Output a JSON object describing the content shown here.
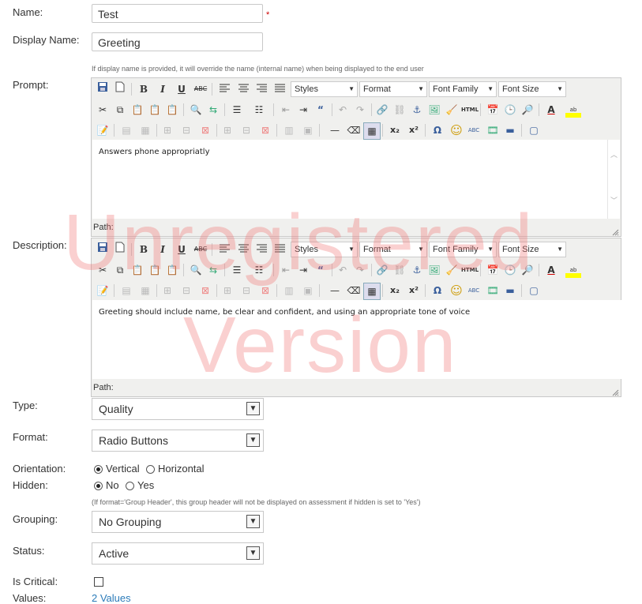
{
  "fields": {
    "name_label": "Name:",
    "name_value": "Test",
    "required_mark": "*",
    "display_name_label": "Display Name:",
    "display_name_value": "Greeting",
    "display_name_hint": "If display name is provided, it will override the name (internal name) when being displayed to the end user",
    "prompt_label": "Prompt:",
    "description_label": "Description:",
    "type_label": "Type:",
    "type_value": "Quality",
    "format_label": "Format:",
    "format_value": "Radio Buttons",
    "orientation_label": "Orientation:",
    "orientation_vertical": "Vertical",
    "orientation_horizontal": "Horizontal",
    "hidden_label": "Hidden:",
    "hidden_no": "No",
    "hidden_yes": "Yes",
    "hidden_hint": "(If format='Group Header', this group header will not be displayed on assessment if hidden is set to 'Yes')",
    "grouping_label": "Grouping:",
    "grouping_value": "No Grouping",
    "status_label": "Status:",
    "status_value": "Active",
    "critical_label": "Is Critical:",
    "values_label": "Values:",
    "values_link": "2 Values"
  },
  "editor": {
    "styles": "Styles",
    "format": "Format",
    "font_family": "Font Family",
    "font_size": "Font Size",
    "path_label": "Path:",
    "prompt_text": "Answers phone appropriatly",
    "description_text": "Greeting should include name, be clear and confident, and using an appropriate tone of voice",
    "glyphs": {
      "bold": "B",
      "italic": "I",
      "underline": "U",
      "strike": "ABC",
      "html": "HTML",
      "subscript": "x₂",
      "superscript": "x²",
      "omega": "Ω",
      "smiley": "☺",
      "font_color": "A",
      "spell": "ABC"
    }
  },
  "watermark": {
    "line1": "Unregistered",
    "line2": "Version"
  },
  "colors": {
    "accent_link": "#2b7bb9",
    "required": "#cc0000",
    "watermark": "#f06e6e"
  }
}
